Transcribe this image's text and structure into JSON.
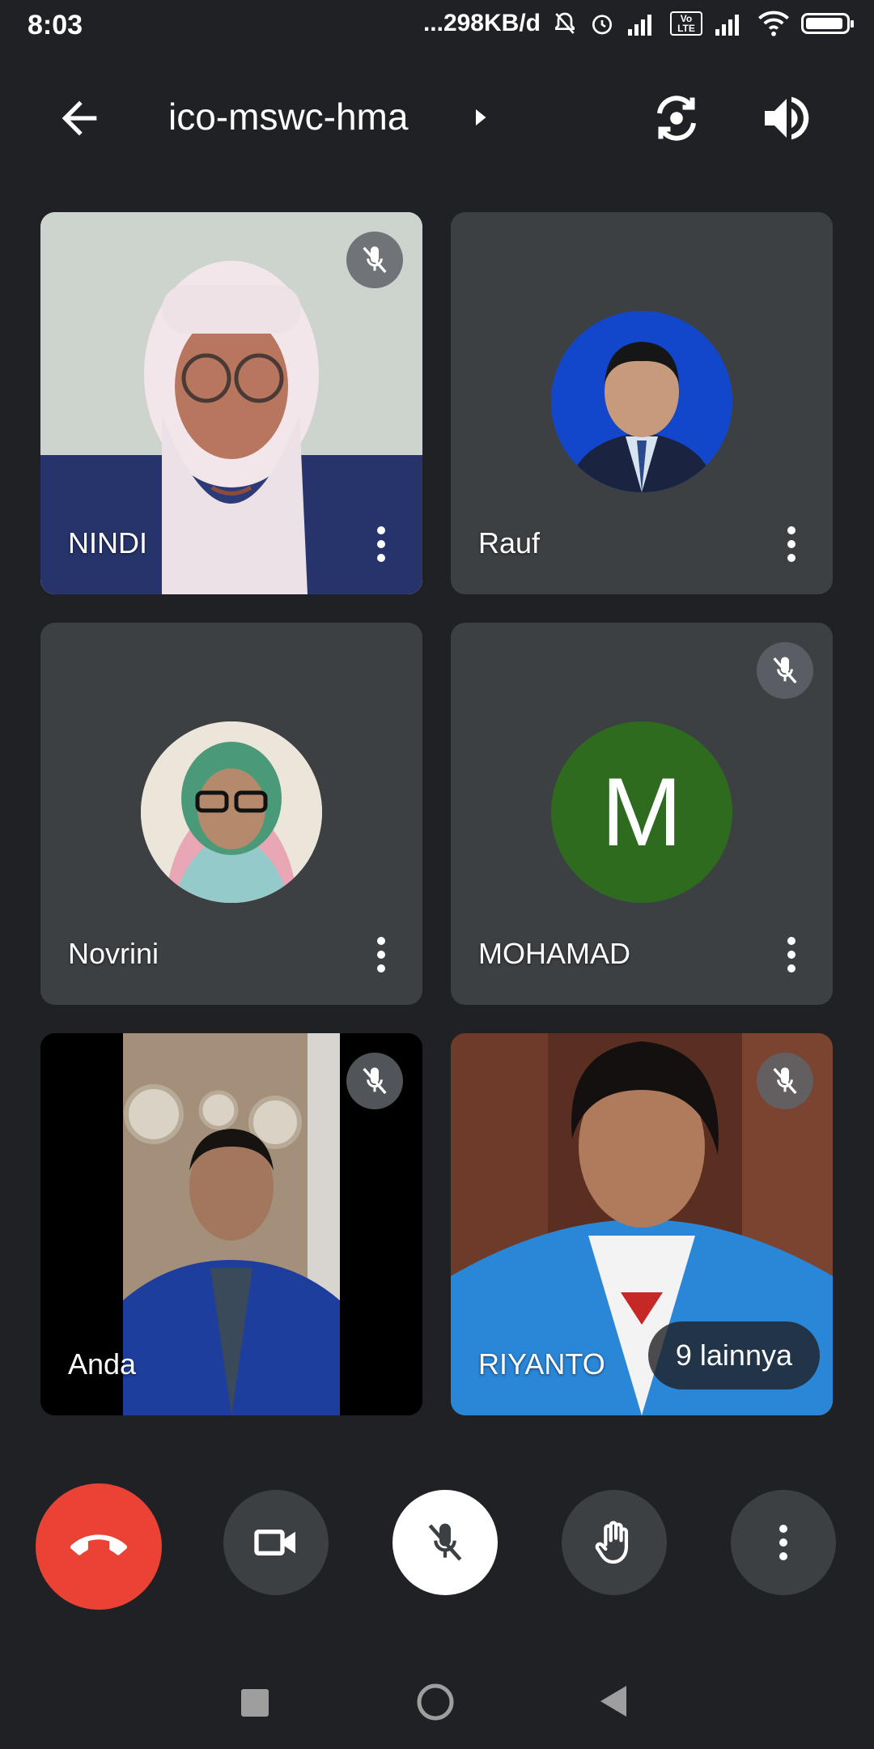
{
  "status_bar": {
    "time": "8:03",
    "net_speed": "...298KB/d",
    "volte": "Vo LTE"
  },
  "header": {
    "meeting_code": "ico-mswc-hma"
  },
  "tiles": [
    {
      "name": "NINDI",
      "muted": true,
      "type": "video"
    },
    {
      "name": "Rauf",
      "muted": false,
      "type": "photo-avatar"
    },
    {
      "name": "Novrini",
      "muted": false,
      "type": "photo-avatar"
    },
    {
      "name": "MOHAMAD",
      "muted": true,
      "type": "letter-avatar",
      "initial": "M",
      "avatar_color": "#2e6b1f"
    },
    {
      "name": "Anda",
      "muted": true,
      "type": "video"
    },
    {
      "name": "RIYANTO",
      "muted": true,
      "type": "video",
      "others_label": "9 lainnya"
    }
  ],
  "colors": {
    "background": "#202124",
    "tile": "#3c4043",
    "hangup": "#ea4335"
  }
}
